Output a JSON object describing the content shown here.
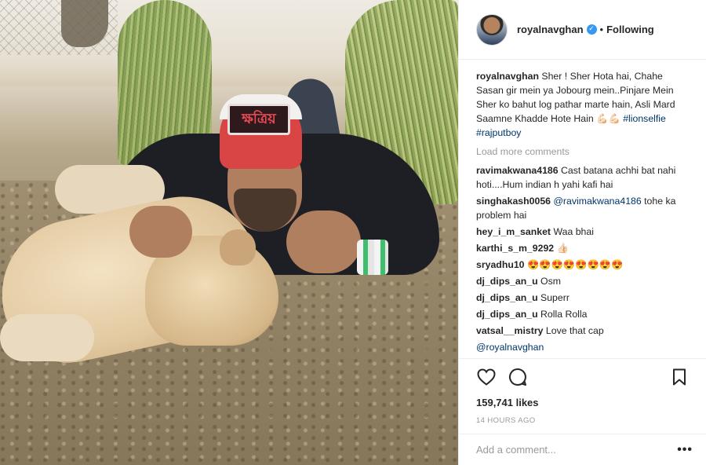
{
  "post": {
    "photo_caption_cap_text": "ক্ষত্রিয়"
  },
  "header": {
    "username": "royalnavghan",
    "verified_glyph": "✓",
    "separator": "•",
    "follow_status": "Following"
  },
  "caption": {
    "username": "royalnavghan",
    "text": "Sher ! Sher Hota hai, Chahe Sasan gir mein ya Jobourg mein..Pinjare Mein Sher ko bahut log pathar marte hain, Asli Mard Saamne Khadde Hote Hain 💪🏻💪🏻",
    "hashtags": "#lionselfie #rajputboy"
  },
  "load_more": "Load more comments",
  "comments": [
    {
      "user": "ravimakwana4186",
      "text": "Cast batana achhi bat nahi hoti....Hum indian h yahi kafi hai"
    },
    {
      "user": "singhakash0056",
      "mention": "@ravimakwana4186",
      "text": "tohe ka problem hai"
    },
    {
      "user": "hey_i_m_sanket",
      "text": "Waa bhai"
    },
    {
      "user": "karthi_s_m_9292",
      "text": "👍🏻"
    },
    {
      "user": "sryadhu10",
      "text": "😍😍😍😍😍😍😍😍"
    },
    {
      "user": "dj_dips_an_u",
      "text": "Osm"
    },
    {
      "user": "dj_dips_an_u",
      "text": "Superr"
    },
    {
      "user": "dj_dips_an_u",
      "text": "Rolla Rolla"
    },
    {
      "user": "vatsal__mistry",
      "text": "Love that cap"
    },
    {
      "user": "",
      "mention": "@royalnavghan",
      "text": ""
    }
  ],
  "actions": {
    "like_icon": "heart-icon",
    "comment_icon": "speech-bubble-icon",
    "save_icon": "bookmark-icon",
    "likes": "159,741 likes",
    "timestamp": "14 HOURS AGO"
  },
  "add_comment": {
    "placeholder": "Add a comment...",
    "more_label": "•••"
  }
}
